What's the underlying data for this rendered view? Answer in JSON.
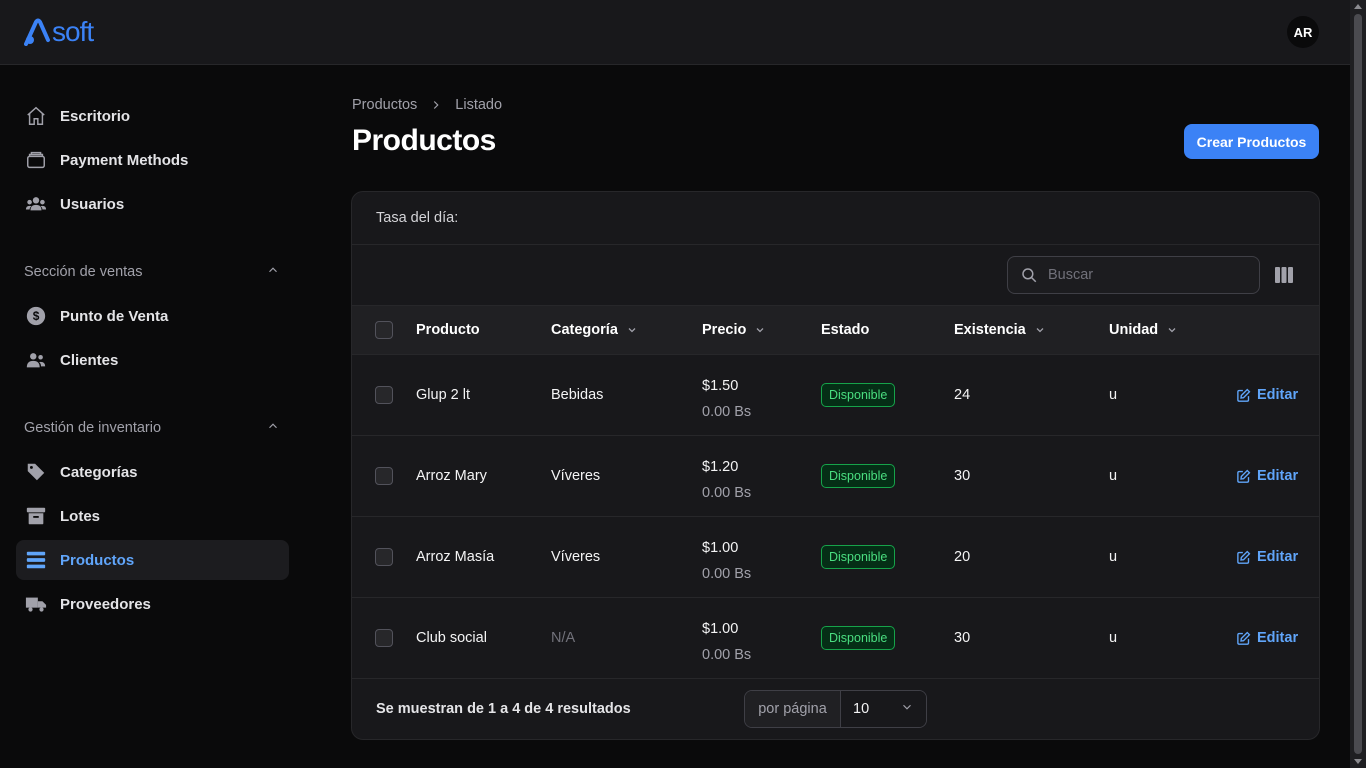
{
  "brand": {
    "logo_text": "soft",
    "accent": "#3b82f6"
  },
  "user": {
    "initials": "AR"
  },
  "sidebar": {
    "items_top": [
      {
        "label": "Escritorio",
        "icon": "home-icon"
      },
      {
        "label": "Payment Methods",
        "icon": "wallet-icon"
      },
      {
        "label": "Usuarios",
        "icon": "users-icon"
      }
    ],
    "groups": [
      {
        "label": "Sección de ventas",
        "items": [
          {
            "label": "Punto de Venta",
            "icon": "dollar-icon"
          },
          {
            "label": "Clientes",
            "icon": "clients-icon"
          }
        ]
      },
      {
        "label": "Gestión de inventario",
        "items": [
          {
            "label": "Categorías",
            "icon": "tag-icon"
          },
          {
            "label": "Lotes",
            "icon": "archive-icon"
          },
          {
            "label": "Productos",
            "icon": "list-icon",
            "active": true
          },
          {
            "label": "Proveedores",
            "icon": "truck-icon"
          }
        ]
      }
    ]
  },
  "breadcrumb": [
    "Productos",
    "Listado"
  ],
  "page": {
    "title": "Productos",
    "create_label": "Crear Productos"
  },
  "card": {
    "tasa_label": "Tasa del día:"
  },
  "search": {
    "placeholder": "Buscar"
  },
  "table": {
    "columns": [
      "Producto",
      "Categoría",
      "Precio",
      "Estado",
      "Existencia",
      "Unidad"
    ],
    "rows": [
      {
        "producto": "Glup 2 lt",
        "categoria": "Bebidas",
        "precio": "$1.50",
        "bs": "0.00 Bs",
        "estado": "Disponible",
        "existencia": "24",
        "unidad": "u",
        "accion": "Editar"
      },
      {
        "producto": "Arroz Mary",
        "categoria": "Víveres",
        "precio": "$1.20",
        "bs": "0.00 Bs",
        "estado": "Disponible",
        "existencia": "30",
        "unidad": "u",
        "accion": "Editar"
      },
      {
        "producto": "Arroz Masía",
        "categoria": "Víveres",
        "precio": "$1.00",
        "bs": "0.00 Bs",
        "estado": "Disponible",
        "existencia": "20",
        "unidad": "u",
        "accion": "Editar"
      },
      {
        "producto": "Club social",
        "categoria": "N/A",
        "precio": "$1.00",
        "bs": "0.00 Bs",
        "estado": "Disponible",
        "existencia": "30",
        "unidad": "u",
        "accion": "Editar"
      }
    ]
  },
  "footer": {
    "summary": "Se muestran de 1 a 4 de 4 resultados",
    "per_page_label": "por página",
    "per_page_value": "10"
  }
}
